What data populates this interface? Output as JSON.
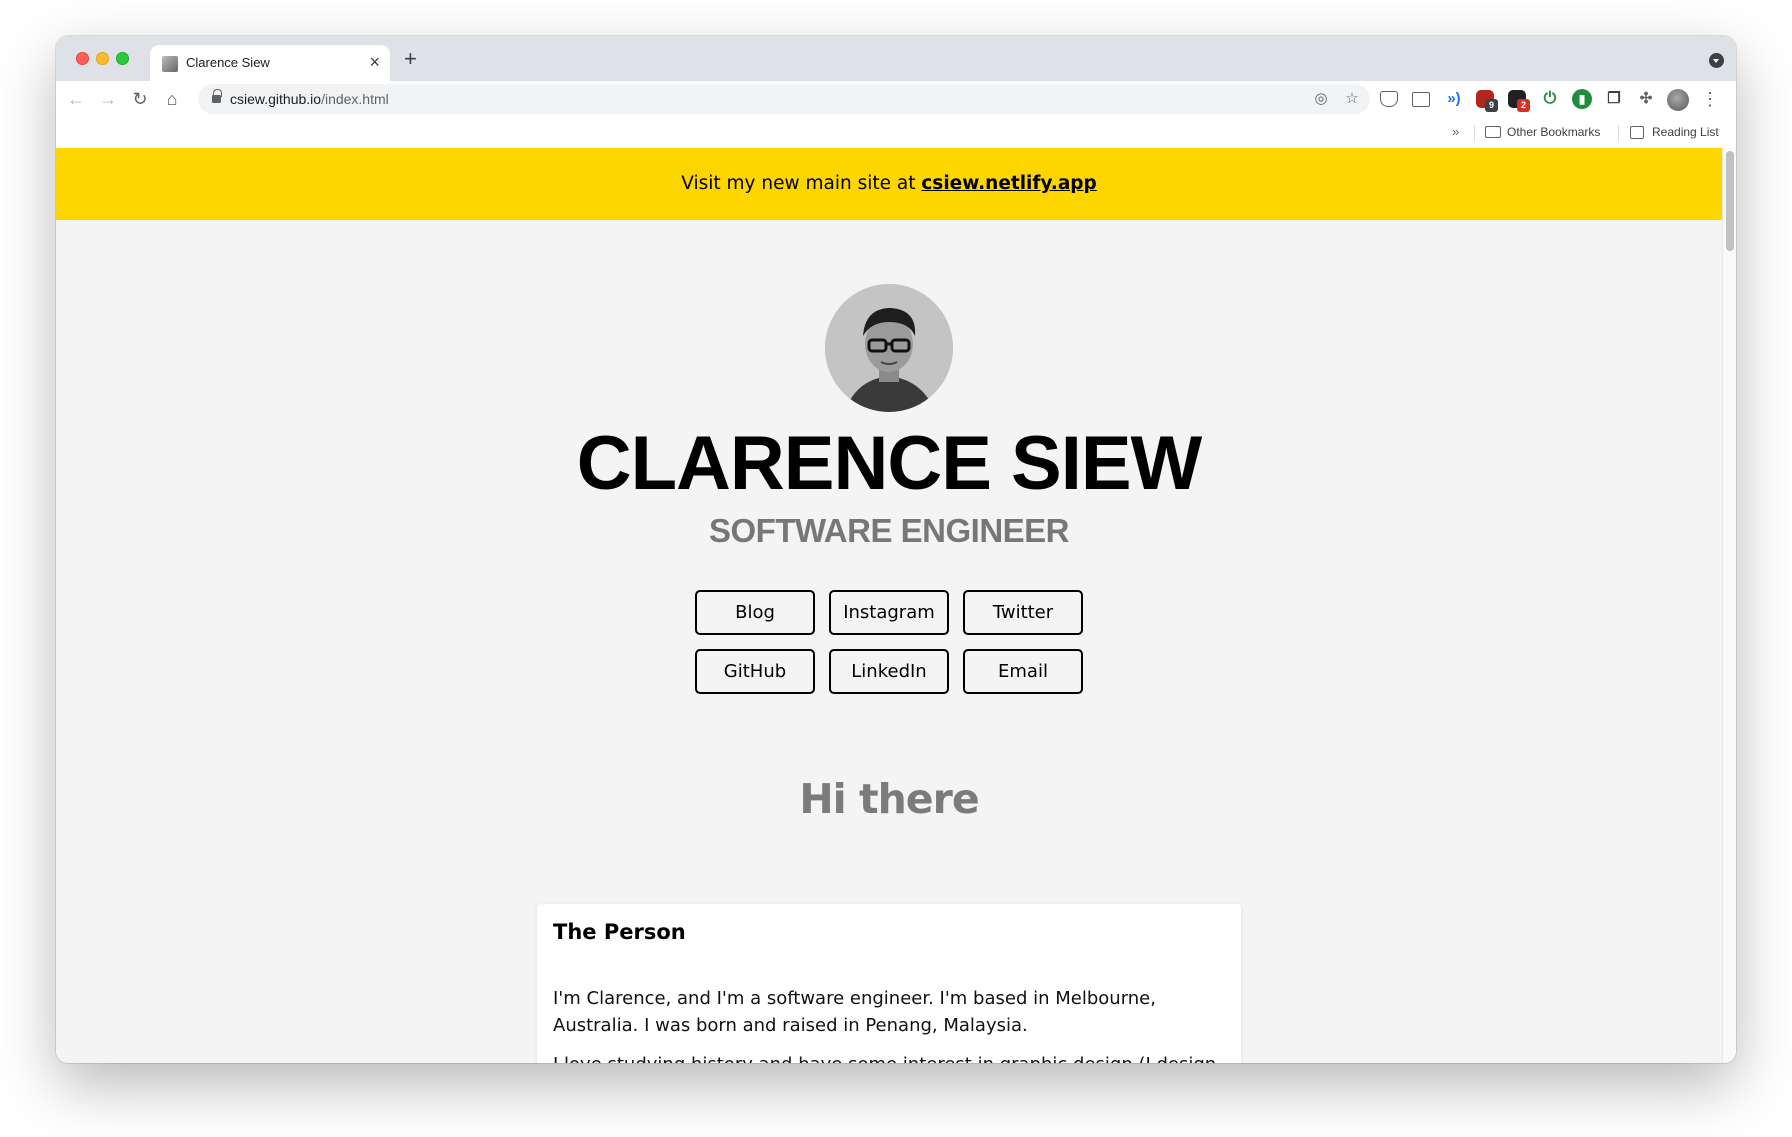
{
  "browser": {
    "tab_title": "Clarence Siew",
    "url_host": "csiew.github.io",
    "url_path": "/index.html",
    "bookmarks": {
      "more": "»",
      "other_bookmarks": "Other Bookmarks",
      "reading_list": "Reading List"
    },
    "extension_badges": {
      "shield": "9",
      "inbox": "2"
    }
  },
  "banner": {
    "text": "Visit my new main site at ",
    "link": "csiew.netlify.app"
  },
  "hero": {
    "name": "CLARENCE SIEW",
    "role": "SOFTWARE ENGINEER"
  },
  "links": [
    {
      "label": "Blog"
    },
    {
      "label": "Instagram"
    },
    {
      "label": "Twitter"
    },
    {
      "label": "GitHub"
    },
    {
      "label": "LinkedIn"
    },
    {
      "label": "Email"
    }
  ],
  "about": {
    "heading": "Hi there",
    "card_title": "The Person",
    "para1": "I'm Clarence, and I'm a software engineer. I'm based in Melbourne, Australia. I was born and raised in Penang, Malaysia.",
    "para2": "I love studying history and have some interest in graphic design (I design all visual assets for my projects myself)."
  },
  "colors": {
    "banner": "#fdd600",
    "page_bg": "#f4f4f4",
    "role_gray": "#777777"
  }
}
